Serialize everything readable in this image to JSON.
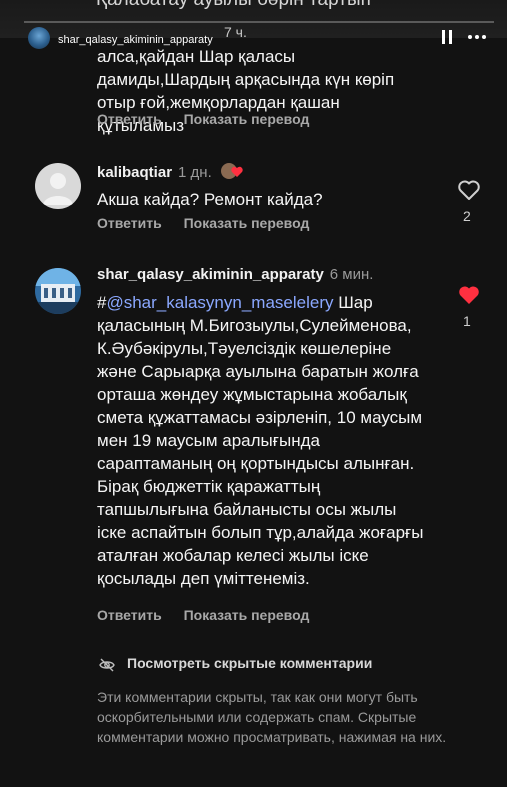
{
  "story": {
    "username": "shar_qalasy_akiminin_apparaty",
    "time": "7 ч.",
    "cut_text": "Қалабатау ауылы бәрін тартып"
  },
  "comments": [
    {
      "text": "алса,қайдан Шар қаласы дамиды,Шардың арқасында күн көріп отыр ғой,жемқорлардан қашан құтыламыз",
      "reply": "Ответить",
      "translate": "Показать перевод"
    },
    {
      "username": "kalibaqtiar",
      "time": "1 дн.",
      "text": "Акша кайда? Ремонт кайда?",
      "reply": "Ответить",
      "translate": "Показать перевод",
      "likes": "2"
    },
    {
      "username": "shar_qalasy_akiminin_apparaty",
      "time": "6 мин.",
      "text_prefix": "#",
      "mention": "@shar_kalasynyn_maselelery",
      "text": " Шар қаласының М.Бигозыулы,Сулейменова, К.Әубәкірулы,Тәуелсіздік көшелеріне және Сарыарқа ауылына баратын жолға орташа жөндеу жұмыстарына жобалық смета құжаттамасы әзірленіп, 10 маусым мен 19 маусым аралығында сараптаманың оң қортындысы алынған. Бірақ бюджеттік қаражаттың тапшылығына байланысты осы жылы іске аспайтын болып тұр,алайда жоғарғы аталған жобалар келесі жылы іске қосылады деп үміттенеміз.",
      "reply": "Ответить",
      "translate": "Показать перевод",
      "likes": "1"
    }
  ],
  "hidden": {
    "label": "Посмотреть скрытые комментарии",
    "description": "Эти комментарии скрыты, так как они могут быть оскорбительными или содержать спам. Скрытые комментарии можно просматривать, нажимая на них."
  },
  "colors": {
    "background": "#121212",
    "like_red": "#ff3040",
    "mention_blue": "#8ba8ff"
  }
}
